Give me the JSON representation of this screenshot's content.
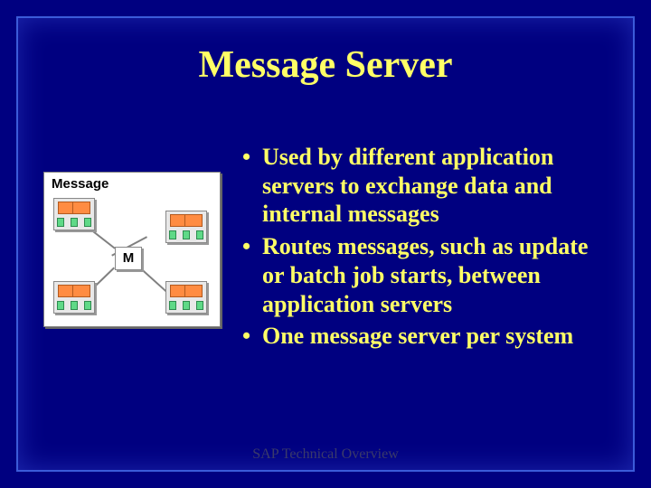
{
  "title": "Message Server",
  "diagram": {
    "label": "Message",
    "center_label": "M"
  },
  "bullets": [
    "Used by different application servers to exchange data and internal messages",
    "Routes messages, such as update or batch job starts, between application servers",
    "One message server per system"
  ],
  "footer": "SAP Technical Overview"
}
